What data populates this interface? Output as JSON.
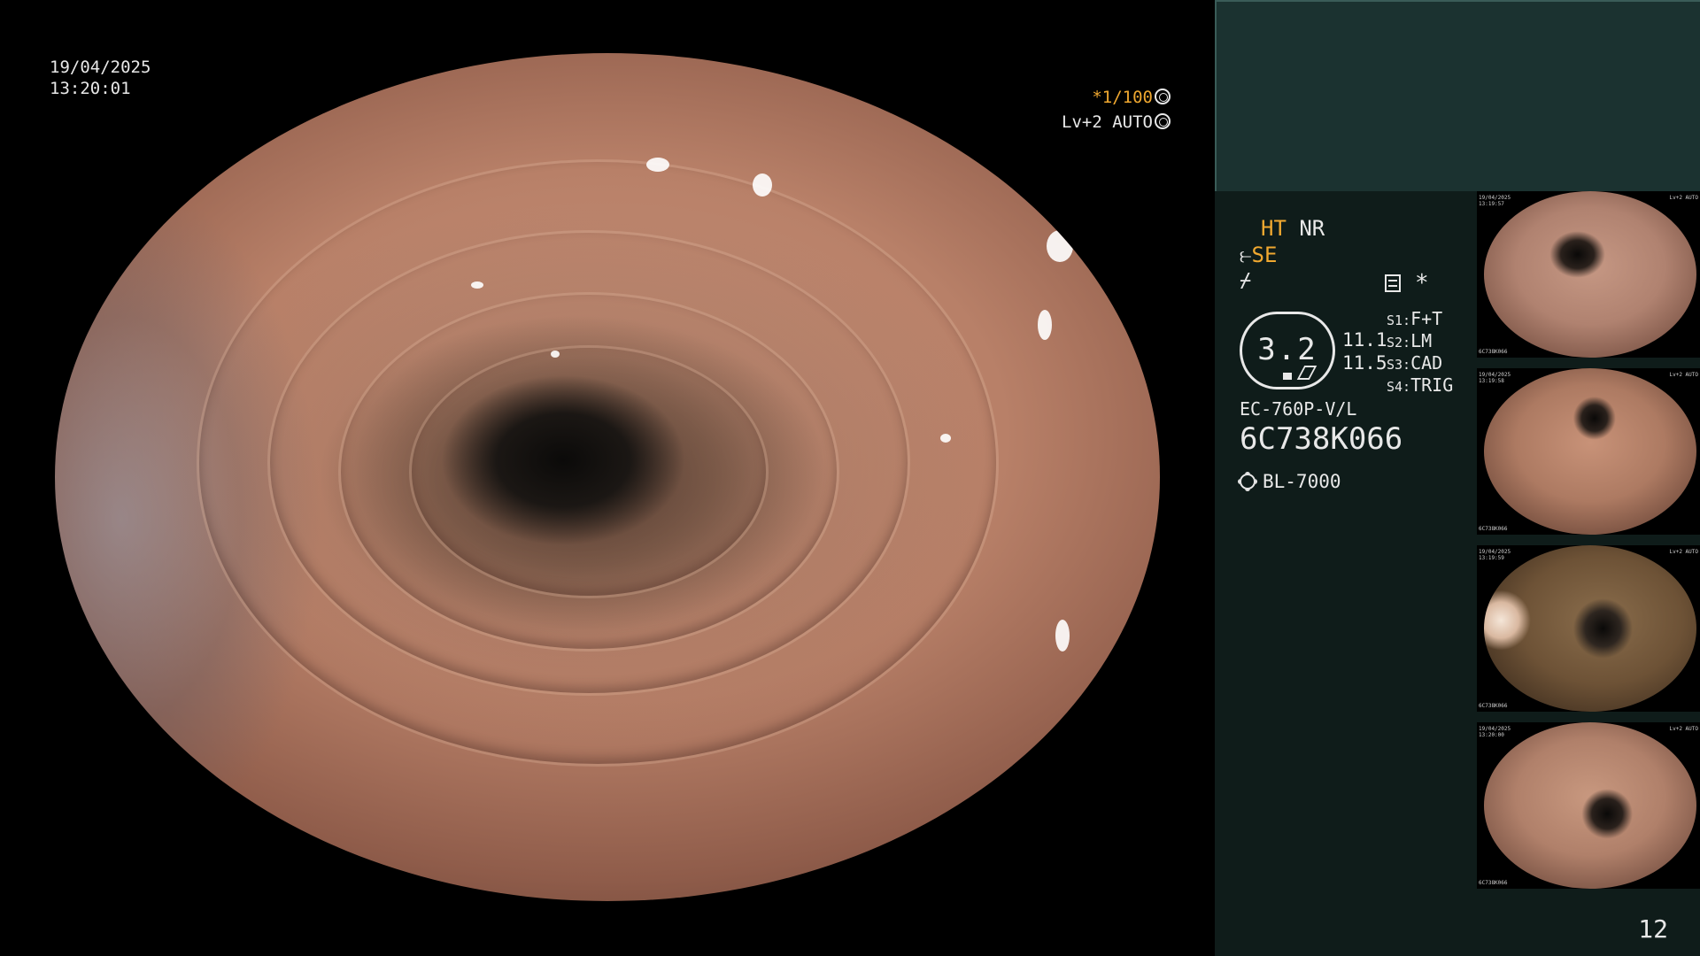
{
  "osd": {
    "date": "19/04/2025",
    "time": "13:20:01",
    "shutter_prefix": "*1/100",
    "level": "Lv+2 AUTO"
  },
  "panel": {
    "mode_ht": "HT",
    "mode_nr": "NR",
    "se_label": "SE",
    "star": "*",
    "zoom_value": "3.2",
    "value_a": "11.1",
    "value_b": "11.5",
    "switches": [
      {
        "key": "S1:",
        "value": "F+T"
      },
      {
        "key": "S2:",
        "value": "LM"
      },
      {
        "key": "S3:",
        "value": "CAD"
      },
      {
        "key": "S4:",
        "value": "TRIG"
      }
    ],
    "scope_model": "EC-760P-V/L",
    "scope_serial": "6C738K066",
    "light_source": "BL-7000",
    "page_number": "12"
  },
  "thumbnails": [
    {
      "date": "19/04/2025",
      "time": "13:19:57",
      "serial": "6C738K066",
      "level": "Lv+2 AUTO"
    },
    {
      "date": "19/04/2025",
      "time": "13:19:58",
      "serial": "6C738K066",
      "level": "Lv+2 AUTO"
    },
    {
      "date": "19/04/2025",
      "time": "13:19:59",
      "serial": "6C738K066",
      "level": "Lv+2 AUTO"
    },
    {
      "date": "19/04/2025",
      "time": "13:20:00",
      "serial": "6C738K066",
      "level": "Lv+2 AUTO"
    }
  ],
  "colors": {
    "accent": "#f0a830",
    "panel_top": "#1b3230",
    "panel_bg": "#0f1c1a",
    "text": "#e8e8e8"
  },
  "icons": [
    "aperture-icon",
    "auto-ring-icon",
    "structure-enhance-icon",
    "edge-icon",
    "memo-icon",
    "light-source-icon"
  ]
}
